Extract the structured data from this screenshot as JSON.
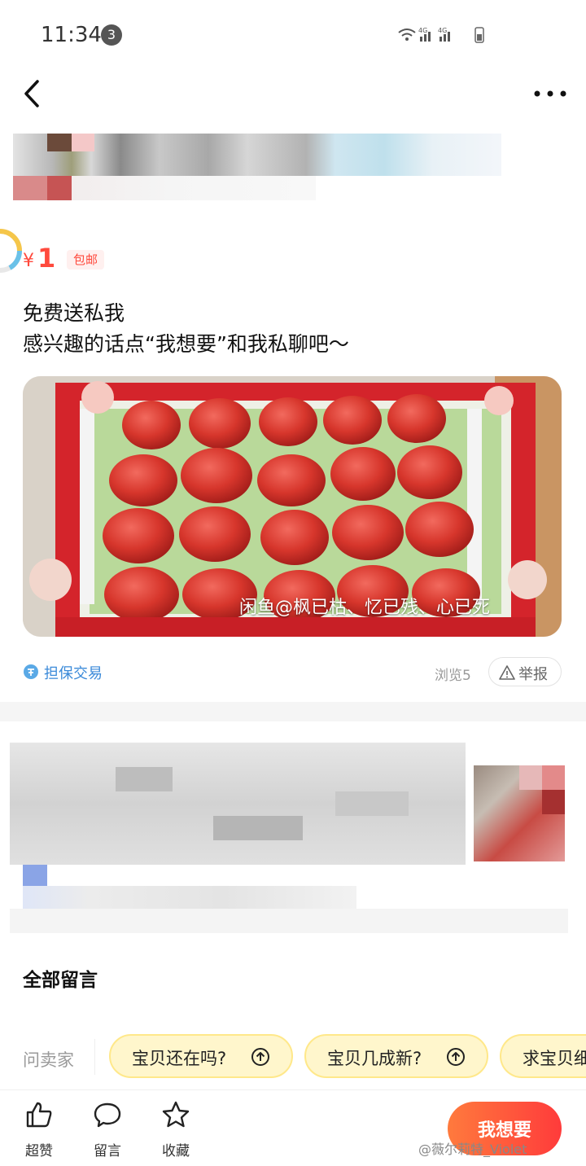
{
  "status_bar": {
    "time": "11:34",
    "notification_count": "3"
  },
  "price": {
    "symbol": "¥",
    "value": "1",
    "tag": "包邮"
  },
  "description": {
    "line1": "免费送私我",
    "line2": "感兴趣的话点“我想要”和我私聊吧～"
  },
  "photo": {
    "watermark": "闲鱼@枫已枯、忆已残、心已死"
  },
  "meta": {
    "guarantee": "担保交易",
    "views": "浏览5",
    "report": "举报"
  },
  "comments": {
    "title": "全部留言"
  },
  "quick_questions": {
    "ask_seller": "问卖家",
    "chips": [
      "宝贝还在吗?",
      "宝贝几成新?",
      "求宝贝细节"
    ]
  },
  "bottom_bar": {
    "like": "超赞",
    "comment": "留言",
    "favorite": "收藏",
    "want": "我想要"
  },
  "credit": "@薇尔莉特_Violet",
  "colors": {
    "accent": "#ff4a3d",
    "chip_bg": "#fff6cc",
    "link_blue": "#3b8ad9"
  },
  "icons": [
    "back-icon",
    "more-icon",
    "guarantee-icon",
    "warning-icon",
    "up-arrow-icon",
    "thumbs-up-icon",
    "speech-bubble-icon",
    "star-icon"
  ]
}
